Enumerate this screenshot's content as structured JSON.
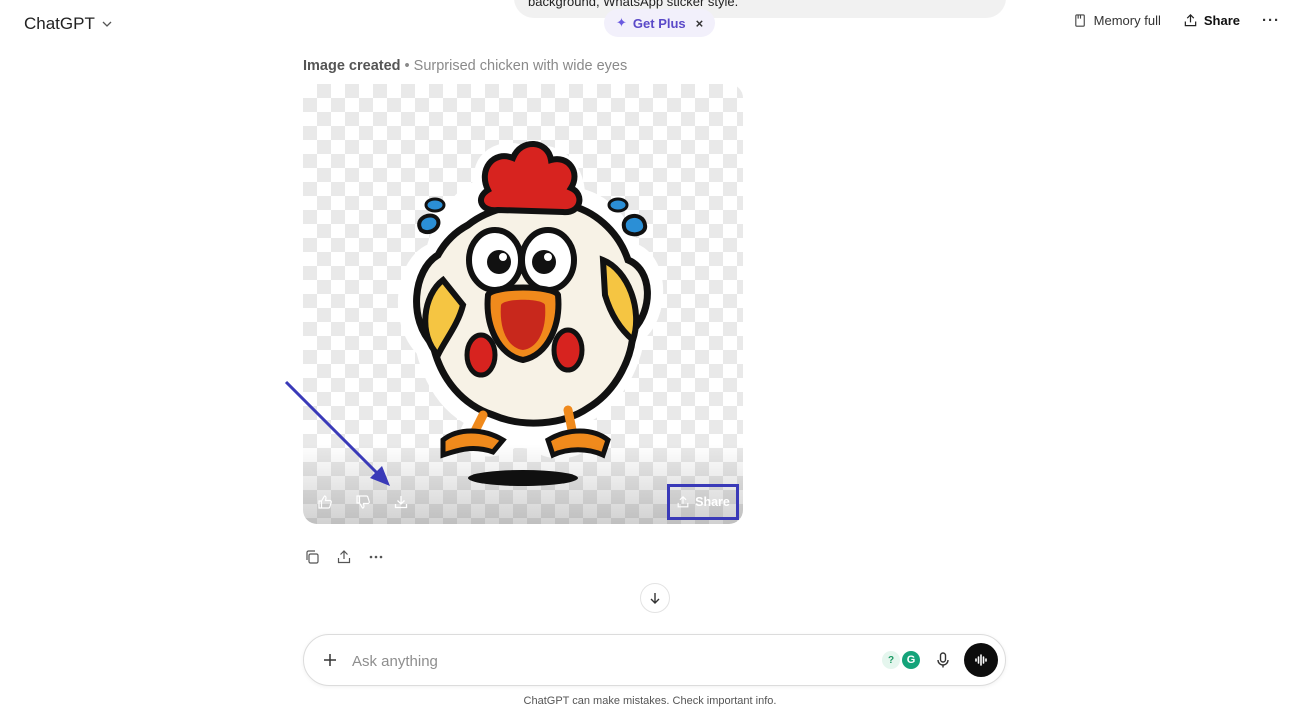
{
  "header": {
    "app_title": "ChatGPT",
    "previous_message_fragment": "background, WhatsApp sticker style.",
    "get_plus_label": "Get Plus",
    "get_plus_close": "×",
    "memory_label": "Memory full",
    "share_label": "Share",
    "more_label": "···"
  },
  "message": {
    "status_label": "Image created",
    "separator": " • ",
    "image_title": "Surprised chicken with wide eyes",
    "image_share_label": "Share",
    "image_actions": [
      "thumbs-up-icon",
      "thumbs-down-icon",
      "download-icon"
    ],
    "message_actions": [
      "copy-icon",
      "share-icon",
      "more-icon"
    ]
  },
  "composer": {
    "placeholder": "Ask anything",
    "extension_1": "?",
    "extension_2": "G"
  },
  "footer": {
    "disclaimer": "ChatGPT can make mistakes. Check important info."
  },
  "colors": {
    "annotation_blue": "#3a3ab8",
    "get_plus_accent": "#5a49c8"
  }
}
